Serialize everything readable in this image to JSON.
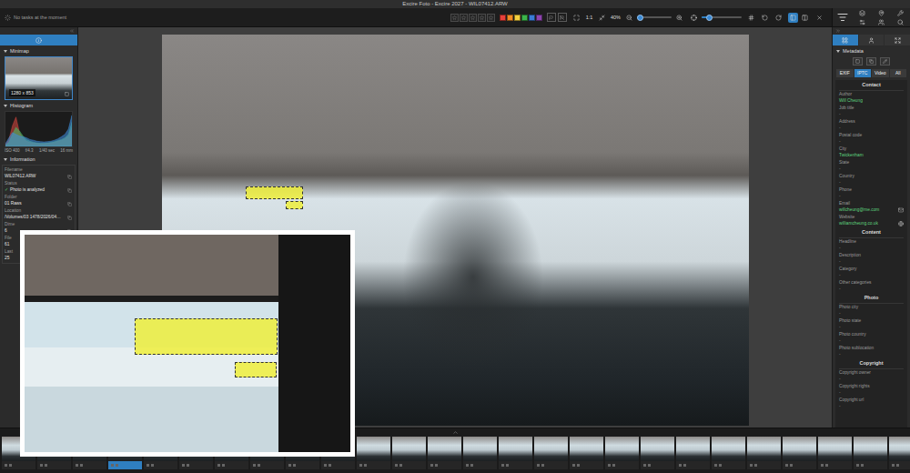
{
  "window": {
    "title": "Excire Foto - Excire 2027 - WIL07412.ARW"
  },
  "toolbar": {
    "task_status": "No tasks at the moment",
    "stars": 0,
    "color_labels": [
      {
        "color": "#e8403a",
        "selected": false
      },
      {
        "color": "#f08a24",
        "selected": false
      },
      {
        "color": "#f4d03f",
        "selected": false
      },
      {
        "color": "#3cb44b",
        "selected": false
      },
      {
        "color": "#3a7bd5",
        "selected": false
      },
      {
        "color": "#8e44ad",
        "selected": false
      }
    ],
    "flags": [
      {
        "kind": "pick",
        "selected": false
      },
      {
        "kind": "reject",
        "selected": false
      }
    ],
    "zoom_actual": "1:1",
    "zoom": "40%",
    "zoom_level": 0.1,
    "brightness_level": 0.2,
    "views": [
      {
        "kind": "single",
        "selected": true
      },
      {
        "kind": "compare",
        "selected": false
      }
    ]
  },
  "left_panel": {
    "tabs": [
      {
        "kind": "info",
        "selected": true
      }
    ],
    "minimap": {
      "title": "Minimap",
      "expanded": true,
      "dimensions": "1280 x 853"
    },
    "histogram": {
      "title": "Histogram",
      "expanded": true,
      "series": [
        {
          "name": "red",
          "color": "#e0493f",
          "values": [
            5,
            20,
            60,
            85,
            40,
            25,
            15,
            12,
            10,
            9,
            8,
            8,
            9,
            10,
            12,
            15,
            18,
            22,
            30,
            55
          ]
        },
        {
          "name": "green",
          "color": "#49c46a",
          "values": [
            3,
            12,
            35,
            55,
            45,
            30,
            20,
            15,
            12,
            10,
            9,
            9,
            10,
            12,
            14,
            17,
            20,
            25,
            35,
            70
          ]
        },
        {
          "name": "blue",
          "color": "#3f8fe0",
          "values": [
            8,
            25,
            40,
            35,
            30,
            28,
            25,
            20,
            18,
            15,
            14,
            13,
            14,
            15,
            18,
            22,
            28,
            35,
            50,
            90
          ]
        }
      ],
      "readings": [
        "ISO 400",
        "f/4.3",
        "1/40 sec",
        "16 mm"
      ]
    },
    "information": {
      "title": "Information",
      "expanded": true,
      "fields": [
        {
          "label": "Filename",
          "value": "WIL07412.ARW",
          "mark": ""
        },
        {
          "label": "Status",
          "value": "Photo is analyzed",
          "mark": "✓"
        },
        {
          "label": "Folder",
          "value": "01 Raws",
          "mark": ""
        },
        {
          "label": "Location",
          "value": "/Volumes/03 1478/2026/04…",
          "mark": ""
        },
        {
          "label": "Dime",
          "value": "6",
          "mark": ""
        },
        {
          "label": "File",
          "value": "61",
          "mark": ""
        },
        {
          "label": "Last",
          "value": "25",
          "mark": ""
        }
      ]
    }
  },
  "photo": {
    "text_highlights": [
      {
        "kind": "large"
      },
      {
        "kind": "small"
      }
    ]
  },
  "zoom_inset": {
    "text_highlights": [
      {
        "kind": "large"
      },
      {
        "kind": "small"
      }
    ]
  },
  "right_panel": {
    "tabs": [
      {
        "kind": "metadata",
        "selected": true
      },
      {
        "kind": "people",
        "selected": false
      },
      {
        "kind": "expand",
        "selected": false
      }
    ],
    "title": "Metadata",
    "expanded": true,
    "metadata_tabs": [
      {
        "label": "EXIF",
        "selected": false
      },
      {
        "label": "IPTC",
        "selected": true
      },
      {
        "label": "Video",
        "selected": false
      },
      {
        "label": "All",
        "selected": false
      }
    ],
    "sections": [
      {
        "title": "Contact",
        "fields": [
          {
            "label": "Author",
            "value": "Will Cheung",
            "filled": true,
            "kind": "text"
          },
          {
            "label": "Job title",
            "value": "-",
            "filled": false,
            "kind": "text"
          },
          {
            "label": "Address",
            "value": "-",
            "filled": false,
            "kind": "text"
          },
          {
            "label": "Postal code",
            "value": "-",
            "filled": false,
            "kind": "text"
          },
          {
            "label": "City",
            "value": "Twickenham",
            "filled": true,
            "kind": "text"
          },
          {
            "label": "State",
            "value": "-",
            "filled": false,
            "kind": "text"
          },
          {
            "label": "Country",
            "value": "-",
            "filled": false,
            "kind": "text"
          },
          {
            "label": "Phone",
            "value": "-",
            "filled": false,
            "kind": "text"
          },
          {
            "label": "Email",
            "value": "willcheung@me.com",
            "filled": true,
            "kind": "email"
          },
          {
            "label": "Website",
            "value": "williamcheung.co.uk",
            "filled": true,
            "kind": "link"
          }
        ]
      },
      {
        "title": "Content",
        "fields": [
          {
            "label": "Headline",
            "value": "-",
            "filled": false,
            "kind": "text"
          },
          {
            "label": "Description",
            "value": "-",
            "filled": false,
            "kind": "text"
          },
          {
            "label": "Category",
            "value": "-",
            "filled": false,
            "kind": "text"
          },
          {
            "label": "Other categories",
            "value": "-",
            "filled": false,
            "kind": "text"
          }
        ]
      },
      {
        "title": "Photo",
        "fields": [
          {
            "label": "Photo city",
            "value": "-",
            "filled": false,
            "kind": "text"
          },
          {
            "label": "Photo state",
            "value": "-",
            "filled": false,
            "kind": "text"
          },
          {
            "label": "Photo country",
            "value": "-",
            "filled": false,
            "kind": "text"
          },
          {
            "label": "Photo sublocation",
            "value": "-",
            "filled": false,
            "kind": "text"
          }
        ]
      },
      {
        "title": "Copyright",
        "fields": [
          {
            "label": "Copyright owner",
            "value": "-",
            "filled": false,
            "kind": "text"
          },
          {
            "label": "Copyright rights",
            "value": "-",
            "filled": false,
            "kind": "text"
          },
          {
            "label": "Copyright url",
            "value": "-",
            "filled": false,
            "kind": "text"
          }
        ]
      }
    ]
  },
  "filmstrip": {
    "thumbnails": [
      {
        "selected": false
      },
      {
        "selected": false
      },
      {
        "selected": false
      },
      {
        "selected": true
      },
      {
        "selected": false
      },
      {
        "selected": false
      },
      {
        "selected": false
      },
      {
        "selected": false
      },
      {
        "selected": false
      },
      {
        "selected": false
      },
      {
        "selected": false
      },
      {
        "selected": false
      },
      {
        "selected": false
      },
      {
        "selected": false
      },
      {
        "selected": false
      },
      {
        "selected": false
      },
      {
        "selected": false
      },
      {
        "selected": false
      },
      {
        "selected": false
      },
      {
        "selected": false
      },
      {
        "selected": false
      },
      {
        "selected": false
      },
      {
        "selected": false
      },
      {
        "selected": false
      },
      {
        "selected": false
      },
      {
        "selected": false
      }
    ]
  }
}
